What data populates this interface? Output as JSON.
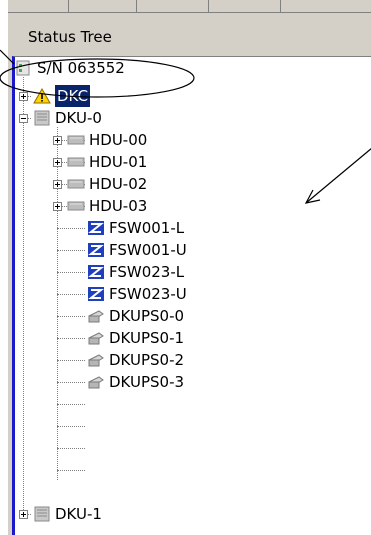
{
  "panel": {
    "title": "Status Tree"
  },
  "tree": {
    "root": {
      "label": "S/N 063552",
      "icon": "storage-root-icon"
    },
    "dkc": {
      "label": "DKC",
      "icon": "warning-icon",
      "status": "warning"
    },
    "dku0": {
      "label": "DKU-0",
      "icon": "disk-unit-icon",
      "hdus": [
        {
          "label": "HDU-00",
          "icon": "hdd-icon"
        },
        {
          "label": "HDU-01",
          "icon": "hdd-icon"
        },
        {
          "label": "HDU-02",
          "icon": "hdd-icon"
        },
        {
          "label": "HDU-03",
          "icon": "hdd-icon"
        }
      ],
      "fsws": [
        {
          "label": "FSW001-L",
          "icon": "switch-icon"
        },
        {
          "label": "FSW001-U",
          "icon": "switch-icon"
        },
        {
          "label": "FSW023-L",
          "icon": "switch-icon"
        },
        {
          "label": "FSW023-U",
          "icon": "switch-icon"
        }
      ],
      "dkups": [
        {
          "label": "DKUPS0-0",
          "icon": "power-supply-icon"
        },
        {
          "label": "DKUPS0-1",
          "icon": "power-supply-icon"
        },
        {
          "label": "DKUPS0-2",
          "icon": "power-supply-icon"
        },
        {
          "label": "DKUPS0-3",
          "icon": "power-supply-icon"
        }
      ]
    },
    "dku1": {
      "label": "DKU-1",
      "icon": "disk-unit-icon"
    }
  },
  "colors": {
    "selection": "#0a246a",
    "switch_blue": "#1f3fbf",
    "warning_yellow": "#ffd400"
  }
}
